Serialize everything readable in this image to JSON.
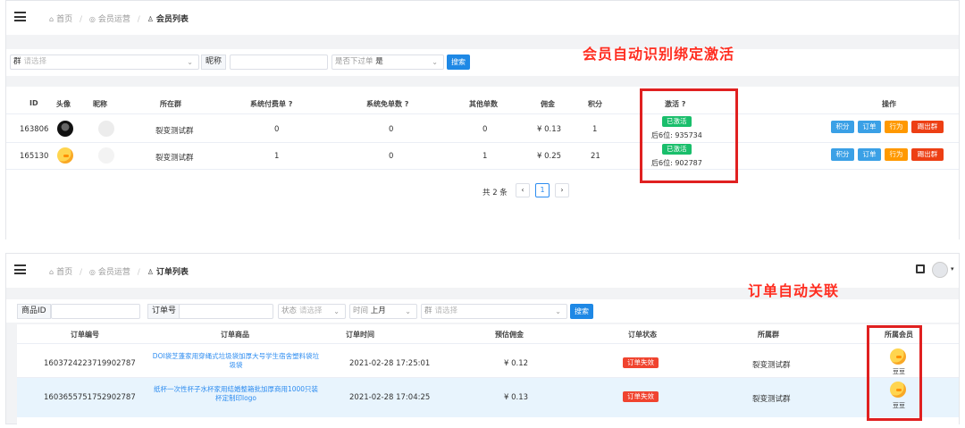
{
  "panel1": {
    "breadcrumb": [
      "首页",
      "会员运营",
      "会员列表"
    ],
    "filters": {
      "group_label": "群",
      "group_placeholder": "请选择",
      "nick_label": "昵称",
      "nick_value": "",
      "order_label": "是否下过单",
      "order_value": "是",
      "search_label": "搜索"
    },
    "columns": [
      "ID",
      "头像",
      "昵称",
      "所在群",
      "系统付费单 ?",
      "系统免单数 ?",
      "其他单数",
      "佣金",
      "积分",
      "激活 ?",
      "操作"
    ],
    "rows": [
      {
        "id": "163806",
        "avatar": "dark-avatar",
        "nick": "",
        "group": "裂变测试群",
        "paid": "0",
        "free": "0",
        "other": "0",
        "commission": "¥ 0.13",
        "points": "1",
        "status": "已激活",
        "code": "后6位: 935734"
      },
      {
        "id": "165130",
        "avatar": "duck-avatar",
        "nick": "",
        "group": "裂变测试群",
        "paid": "1",
        "free": "0",
        "other": "1",
        "commission": "¥ 0.25",
        "points": "21",
        "status": "已激活",
        "code": "后6位: 902787"
      }
    ],
    "actions": [
      "积分",
      "订单",
      "行为",
      "踢出群"
    ],
    "pager": {
      "total": "共 2 条",
      "prev": "‹",
      "page": "1",
      "next": "›"
    },
    "annotation": "会员自动识别绑定激活"
  },
  "panel2": {
    "breadcrumb": [
      "首页",
      "会员运营",
      "订单列表"
    ],
    "filters": {
      "goods_label": "商品ID",
      "order_label": "订单号",
      "status_label": "状态",
      "status_placeholder": "请选择",
      "time_label": "时间",
      "time_value": "上月",
      "group_label": "群",
      "group_placeholder": "请选择",
      "search_label": "搜索"
    },
    "columns": [
      "订单编号",
      "订单商品",
      "订单时间",
      "预估佣金",
      "订单状态",
      "所属群",
      "所属会员"
    ],
    "rows": [
      {
        "no": "1603724223719902787",
        "goods": "DOI袋芝蓬家用穿绳式垃圾袋加厚大号学生宿舍塑料袋垃圾袋",
        "time": "2021-02-28 17:25:01",
        "commission": "¥ 0.12",
        "status": "订单失效",
        "group": "裂变测试群",
        "member": "豆豆"
      },
      {
        "no": "1603655751752902787",
        "goods": "纸杯一次性杯子水杯家用结婚整箱批加厚商用1000只装杯定制印logo",
        "time": "2021-02-28 17:04:25",
        "commission": "¥ 0.13",
        "status": "订单失效",
        "group": "裂变测试群",
        "member": "豆豆"
      }
    ],
    "annotation": "订单自动关联"
  },
  "colors": {
    "accent": "#1e88e5",
    "activated": "#19be6b",
    "invalid": "#f0442f",
    "annotation": "#ff2d20"
  }
}
